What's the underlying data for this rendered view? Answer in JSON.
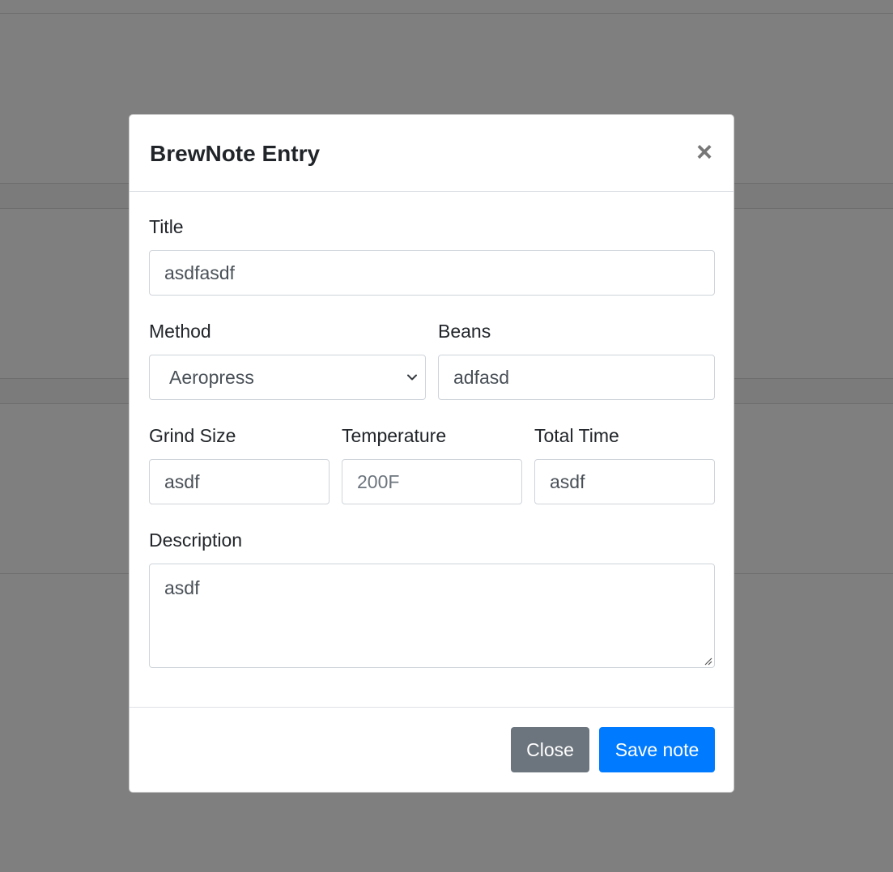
{
  "modal": {
    "title": "BrewNote Entry",
    "close_icon": "close-icon"
  },
  "form": {
    "title": {
      "label": "Title",
      "value": "asdfasdf"
    },
    "method": {
      "label": "Method",
      "value": "Aeropress"
    },
    "beans": {
      "label": "Beans",
      "value": "adfasd"
    },
    "grind_size": {
      "label": "Grind Size",
      "value": "asdf"
    },
    "temperature": {
      "label": "Temperature",
      "placeholder": "200F"
    },
    "total_time": {
      "label": "Total Time",
      "value": "asdf"
    },
    "description": {
      "label": "Description",
      "value": "asdf"
    }
  },
  "footer": {
    "close_label": "Close",
    "save_label": "Save note"
  },
  "colors": {
    "primary": "#007bff",
    "secondary": "#6c757d"
  }
}
